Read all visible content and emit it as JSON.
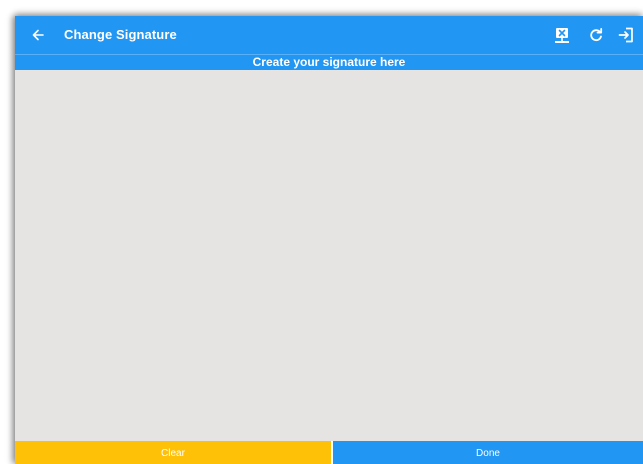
{
  "appbar": {
    "title": "Change Signature",
    "back_icon": "arrow-left-icon",
    "actions": [
      {
        "name": "clear-signature-icon"
      },
      {
        "name": "refresh-icon"
      },
      {
        "name": "logout-icon"
      }
    ]
  },
  "banner": {
    "text": "Create your signature here"
  },
  "footer": {
    "clear_label": "Clear",
    "done_label": "Done"
  },
  "colors": {
    "primary": "#2196f3",
    "accent": "#ffc107",
    "canvas": "#e6e4e3"
  }
}
